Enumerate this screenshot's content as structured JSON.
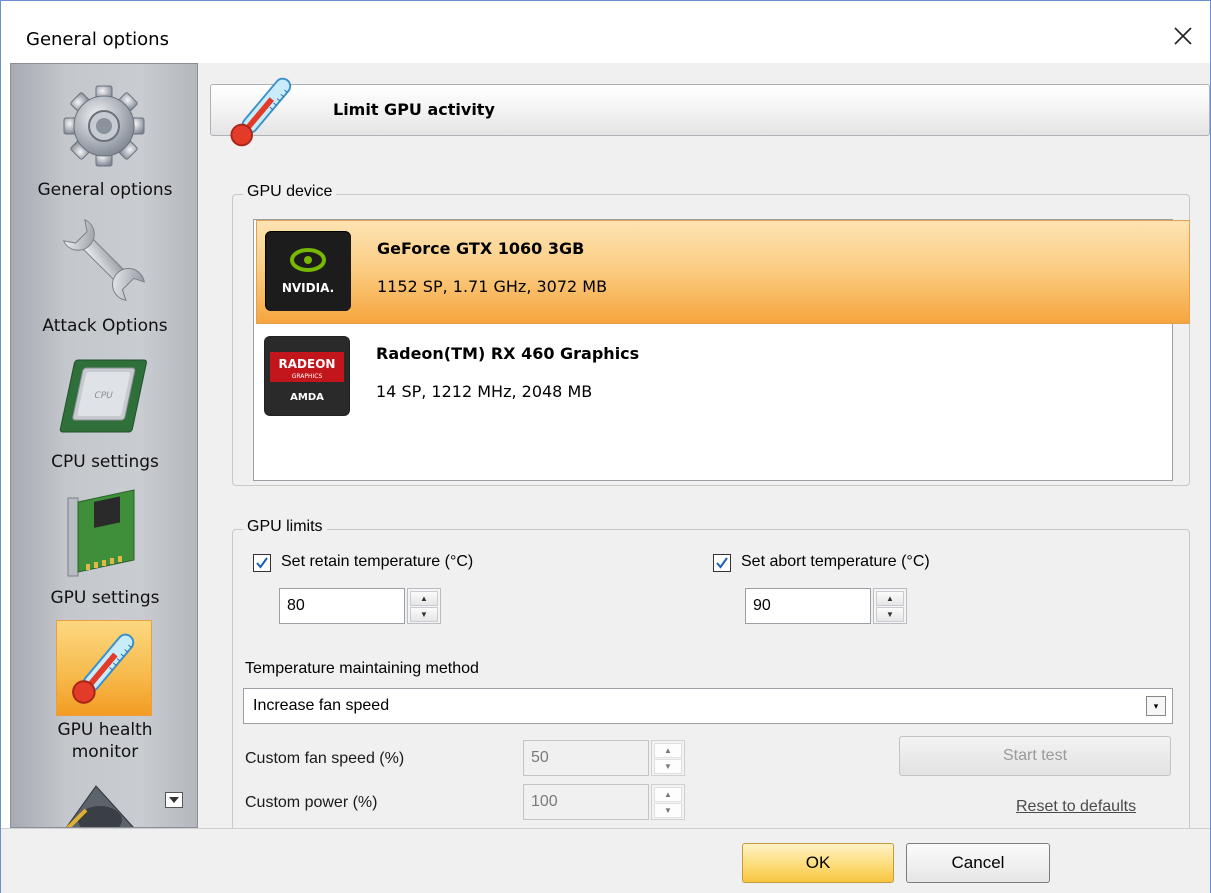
{
  "window": {
    "title": "General options",
    "close_icon": "close-icon"
  },
  "sidebar": {
    "items": [
      {
        "label": "General options",
        "icon": "gear-icon"
      },
      {
        "label": "Attack Options",
        "icon": "wrench-icon"
      },
      {
        "label": "CPU settings",
        "icon": "cpu-chip-icon"
      },
      {
        "label": "GPU settings",
        "icon": "gpu-card-icon"
      },
      {
        "label": "GPU health\nmonitor",
        "label_line1": "GPU health",
        "label_line2": "monitor",
        "icon": "thermometer-icon",
        "active": true
      },
      {
        "label": "",
        "icon": "speaker-icon"
      }
    ],
    "scroll_icon": "scroll-down-icon"
  },
  "header": {
    "title": "Limit GPU activity",
    "icon": "thermometer-icon"
  },
  "gpu_device": {
    "legend": "GPU device",
    "devices": [
      {
        "name": "GeForce GTX 1060 3GB",
        "spec": "1152 SP, 1.71 GHz, 3072 MB",
        "logo_text": "NVIDIA.",
        "selected": true
      },
      {
        "name": "Radeon(TM) RX 460 Graphics",
        "spec": "14 SP, 1212 MHz, 2048 MB",
        "logo_text_1": "RADEON",
        "logo_text_2": "GRAPHICS",
        "logo_text_3": "AMDA",
        "selected": false
      }
    ]
  },
  "gpu_limits": {
    "legend": "GPU limits",
    "retain": {
      "label": "Set retain temperature (°C)",
      "checked": true,
      "value": "80"
    },
    "abort": {
      "label": "Set abort temperature (°C)",
      "checked": true,
      "value": "90"
    },
    "method_label": "Temperature maintaining method",
    "method_value": "Increase fan speed",
    "fan_label": "Custom fan speed (%)",
    "fan_value": "50",
    "power_label": "Custom power (%)",
    "power_value": "100",
    "start_test": "Start test",
    "reset": "Reset to defaults"
  },
  "footer": {
    "ok": "OK",
    "cancel": "Cancel"
  }
}
